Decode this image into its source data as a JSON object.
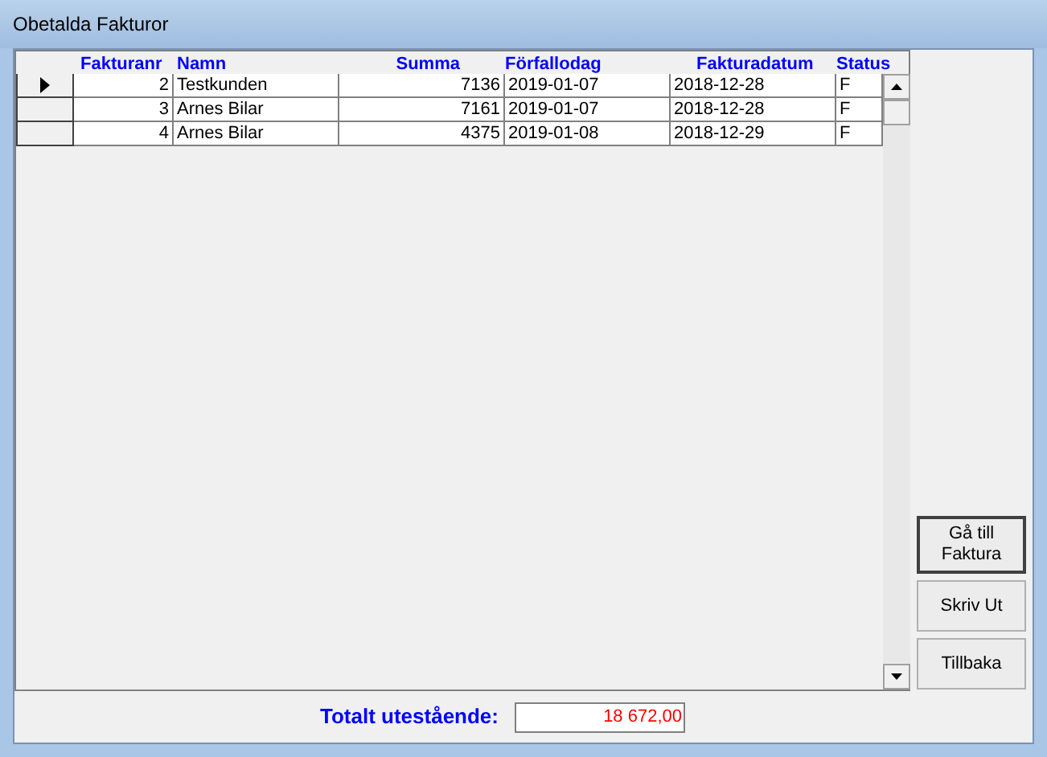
{
  "window": {
    "title": "Obetalda Fakturor"
  },
  "table": {
    "columns": [
      "Fakturanr",
      "Namn",
      "Summa",
      "Förfallodag",
      "Fakturadatum",
      "Status"
    ],
    "rows": [
      {
        "selected": true,
        "cells": [
          "2",
          "Testkunden",
          "7136",
          "2019-01-07",
          "2018-12-28",
          "F"
        ]
      },
      {
        "selected": false,
        "cells": [
          "3",
          "Arnes Bilar",
          "7161",
          "2019-01-07",
          "2018-12-28",
          "F"
        ]
      },
      {
        "selected": false,
        "cells": [
          "4",
          "Arnes Bilar",
          "4375",
          "2019-01-08",
          "2018-12-29",
          "F"
        ]
      }
    ]
  },
  "buttons": [
    {
      "label": "Gå till Faktura",
      "default": true
    },
    {
      "label": "Skriv Ut",
      "default": false
    },
    {
      "label": "Tillbaka",
      "default": false
    }
  ],
  "total": {
    "label": "Totalt utestående:",
    "value": "18 672,00"
  }
}
